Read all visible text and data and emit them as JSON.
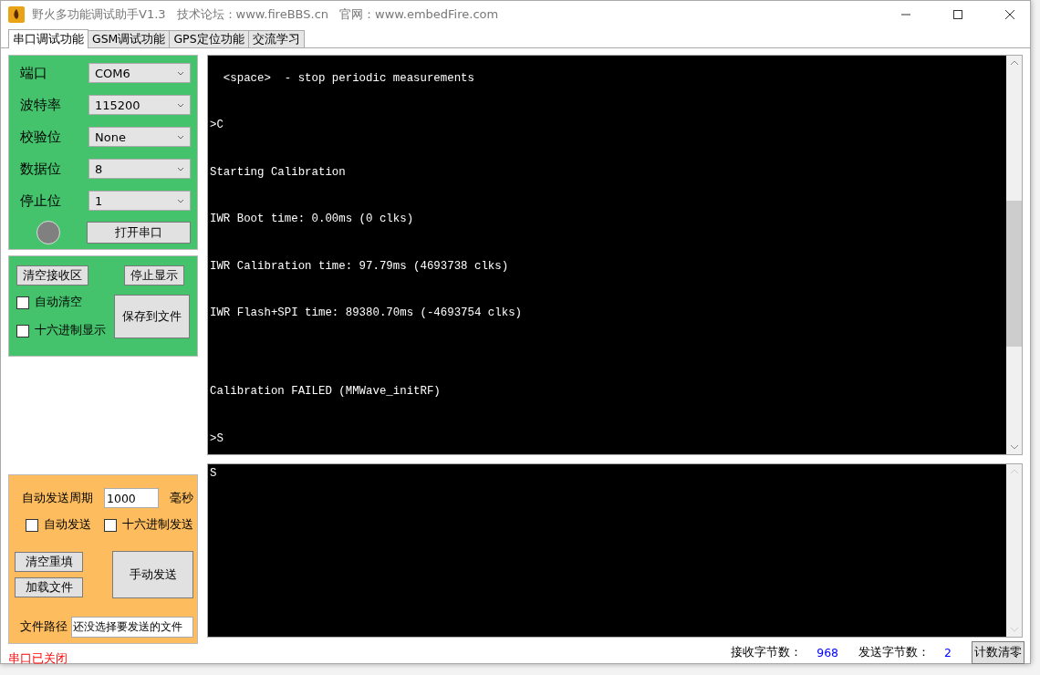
{
  "window": {
    "title": "野火多功能调试助手V1.3",
    "forum": "技术论坛：www.fireBBS.cn",
    "website": "官网：www.embedFire.com"
  },
  "tabs": [
    {
      "label": "串口调试功能",
      "selected": true
    },
    {
      "label": "GSM调试功能",
      "selected": false
    },
    {
      "label": "GPS定位功能",
      "selected": false
    },
    {
      "label": "交流学习",
      "selected": false
    }
  ],
  "serial_settings": [
    {
      "label": "端口",
      "value": "COM6"
    },
    {
      "label": "波特率",
      "value": "115200"
    },
    {
      "label": "校验位",
      "value": "None"
    },
    {
      "label": "数据位",
      "value": "8"
    },
    {
      "label": "停止位",
      "value": "1"
    }
  ],
  "port_indicator": {
    "on": false
  },
  "open_button": "打开串口",
  "receive_controls": {
    "clear_button": "清空接收区",
    "stop_button": "停止显示",
    "save_button": "保存到文件",
    "options": [
      {
        "label": "自动清空",
        "checked": false
      },
      {
        "label": "十六进制显示",
        "checked": false
      }
    ]
  },
  "send_controls": {
    "period_label": "自动发送周期",
    "period_value": "1000",
    "period_unit": "毫秒",
    "options": [
      {
        "label": "自动发送",
        "checked": false
      },
      {
        "label": "十六进制发送",
        "checked": false
      }
    ],
    "clear_button": "清空重填",
    "load_button": "加载文件",
    "send_button": "手动发送",
    "path_label": "文件路径",
    "path_value": "还没选择要发送的文件"
  },
  "port_status": "串口已关闭",
  "receive_text": "  <space>  - stop periodic measurements\n\n\n>C\n\n\nStarting Calibration\n\n\nIWR Boot time: 0.00ms (0 clks)\n\n\nIWR Calibration time: 97.79ms (4693738 clks)\n\n\nIWR Flash+SPI time: 89380.70ms (-4693754 clks)\n\n\n\n\nCalibration FAILED (MMWave_initRF)\n\n\n>S",
  "send_text": "S",
  "counters": [
    {
      "label": "接收字节数：",
      "value": "968"
    },
    {
      "label": "发送字节数：",
      "value": "2"
    }
  ],
  "reset_button": "计数清零"
}
